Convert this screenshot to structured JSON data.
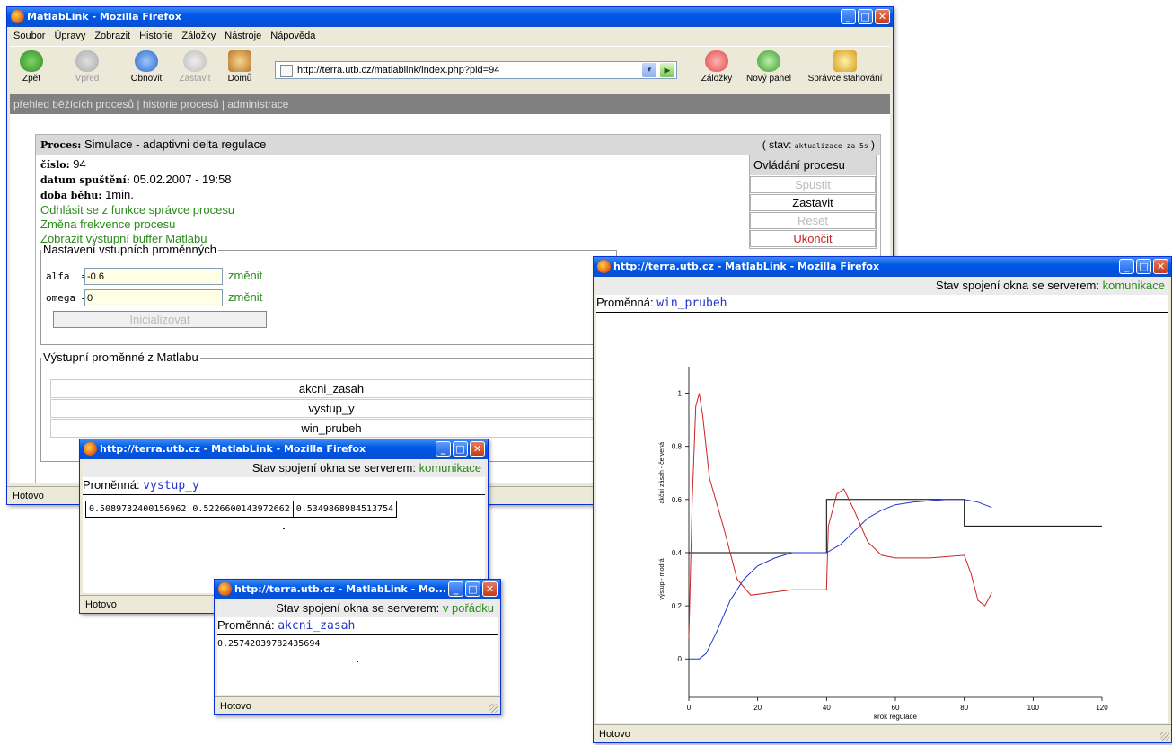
{
  "main_window": {
    "title": "MatlabLink - Mozilla Firefox",
    "menu": [
      "Soubor",
      "Úpravy",
      "Zobrazit",
      "Historie",
      "Záložky",
      "Nástroje",
      "Nápověda"
    ],
    "toolbar": {
      "back": "Zpět",
      "forward": "Vpřed",
      "reload": "Obnovit",
      "stop": "Zastavit",
      "home": "Domů",
      "bookmarks": "Záložky",
      "new_tab": "Nový panel",
      "downloads": "Správce stahování"
    },
    "url": "http://terra.utb.cz/matlablink/index.php?pid=94",
    "nav": "přehled běžících procesů | historie procesů | administrace",
    "process": {
      "label": "Proces:",
      "name": "Simulace - adaptivni delta regulace",
      "state_prefix": "( stav:",
      "state_value": "aktualizace za 5s",
      "state_suffix": ")",
      "cislo_label": "číslo:",
      "cislo": "94",
      "datum_label": "datum spuštění:",
      "datum": "05.02.2007 - 19:58",
      "doba_label": "doba běhu:",
      "doba": "1min.",
      "links": [
        "Odhlásit se z funkce správce procesu",
        "Změna frekvence procesu",
        "Zobrazit výstupní buffer Matlabu"
      ]
    },
    "control": {
      "title": "Ovládání procesu",
      "buttons": [
        "Spustit",
        "Zastavit",
        "Reset",
        "Ukončit"
      ]
    },
    "inputs": {
      "legend": "Nastavení vstupních proměnných",
      "alfa_label": "alfa",
      "alfa_value": "-0.6",
      "omega_label": "omega",
      "omega_value": "0",
      "eq": "=",
      "change": "změnit",
      "init": "Inicializovat"
    },
    "outputs": {
      "legend": "Výstupní proměnné z Matlabu",
      "items": [
        "akcni_zasah",
        "vystup_y",
        "win_prubeh"
      ]
    },
    "status": "Hotovo"
  },
  "popup_vystup": {
    "title": "http://terra.utb.cz - MatlabLink - Mozilla Firefox",
    "conn_label": "Stav spojení okna se serverem:",
    "conn_state": "komunikace",
    "var_label": "Proměnná:",
    "var_name": "vystup_y",
    "values": [
      "0.5089732400156962",
      "0.5226600143972662",
      "0.5349868984513754"
    ],
    "dot": ".",
    "status": "Hotovo"
  },
  "popup_akcni": {
    "title": "http://terra.utb.cz - MatlabLink - Mo...",
    "conn_label": "Stav spojení okna se serverem:",
    "conn_state": "v pořádku",
    "var_label": "Proměnná:",
    "var_name": "akcni_zasah",
    "value": "0.25742039782435694",
    "dot": ".",
    "status": "Hotovo"
  },
  "popup_prubeh": {
    "title": "http://terra.utb.cz - MatlabLink - Mozilla Firefox",
    "conn_label": "Stav spojení okna se serverem:",
    "conn_state": "komunikace",
    "var_label": "Proměnná:",
    "var_name": "win_prubeh",
    "status": "Hotovo"
  },
  "colors": {
    "link_green": "#2b8a1a",
    "var_blue": "#2233cc",
    "stop_red": "#cc2222"
  },
  "chart_data": {
    "type": "line",
    "xlabel": "krok regulace",
    "ylabel_top": "akční zásah - červená",
    "ylabel_bottom": "výstup - modrá",
    "xlim": [
      0,
      120
    ],
    "ylim": [
      -0.05,
      1.1
    ],
    "xticks": [
      0,
      20,
      40,
      60,
      80,
      100,
      120
    ],
    "yticks": [
      0,
      0.2,
      0.4,
      0.6,
      0.8,
      1
    ],
    "series": [
      {
        "color": "#000000",
        "x": [
          0,
          40,
          40,
          80,
          80,
          120
        ],
        "y": [
          0.4,
          0.4,
          0.6,
          0.6,
          0.5,
          0.5
        ]
      },
      {
        "color": "#2233cc",
        "x": [
          0,
          3,
          5,
          8,
          12,
          16,
          20,
          25,
          30,
          40,
          44,
          48,
          52,
          56,
          60,
          65,
          70,
          75,
          80,
          84,
          88
        ],
        "y": [
          0,
          0,
          0.02,
          0.1,
          0.22,
          0.3,
          0.35,
          0.38,
          0.4,
          0.4,
          0.43,
          0.48,
          0.53,
          0.56,
          0.58,
          0.59,
          0.595,
          0.6,
          0.6,
          0.59,
          0.57
        ]
      },
      {
        "color": "#cc2222",
        "x": [
          0,
          1,
          2,
          3,
          4,
          6,
          10,
          14,
          18,
          24,
          30,
          40,
          40.5,
          43,
          45,
          48,
          52,
          56,
          60,
          70,
          80,
          82,
          84,
          86,
          88
        ],
        "y": [
          0.08,
          0.6,
          0.95,
          1.0,
          0.92,
          0.68,
          0.5,
          0.3,
          0.24,
          0.25,
          0.26,
          0.26,
          0.5,
          0.62,
          0.64,
          0.56,
          0.44,
          0.39,
          0.38,
          0.38,
          0.39,
          0.32,
          0.22,
          0.2,
          0.25
        ]
      }
    ]
  }
}
